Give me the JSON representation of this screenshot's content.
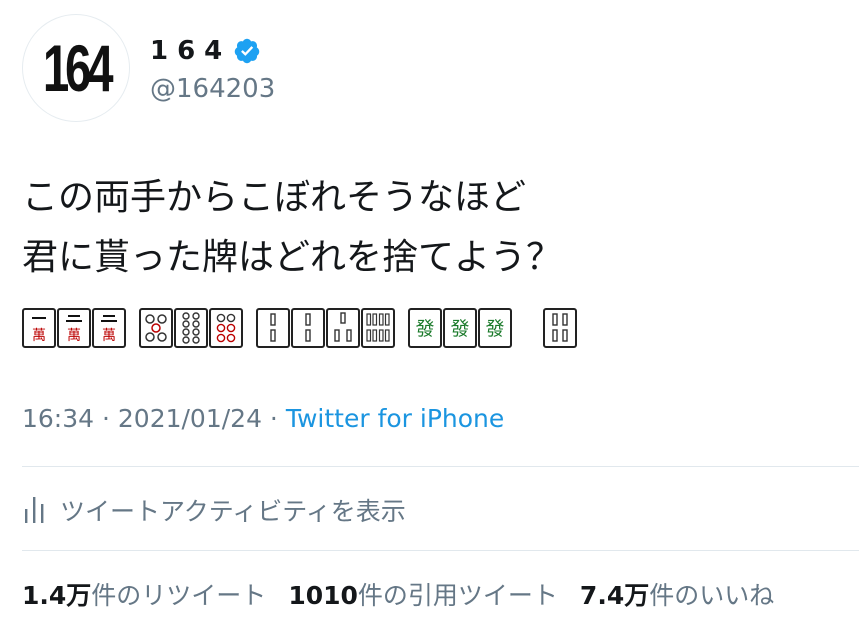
{
  "profile": {
    "avatar_text": "164",
    "display_name": "164",
    "handle": "@164203",
    "verified_icon": "verified-badge-icon",
    "verified_color": "#1da1f2"
  },
  "tweet": {
    "line1": "この両手からこぼれそうなほど",
    "line2": "君に貰った牌はどれを捨てよう？",
    "tiles": [
      {
        "suit": "man",
        "label": "一萬"
      },
      {
        "suit": "man",
        "label": "二萬"
      },
      {
        "suit": "man",
        "label": "二萬"
      },
      {
        "suit": "pin",
        "label": "五筒"
      },
      {
        "suit": "pin",
        "label": "八筒"
      },
      {
        "suit": "pin",
        "label": "六筒"
      },
      {
        "suit": "sou",
        "label": "二索"
      },
      {
        "suit": "sou",
        "label": "二索"
      },
      {
        "suit": "sou",
        "label": "三索"
      },
      {
        "suit": "sou",
        "label": "八索"
      },
      {
        "suit": "honor",
        "label": "發"
      },
      {
        "suit": "honor",
        "label": "發"
      },
      {
        "suit": "honor",
        "label": "發"
      },
      {
        "suit": "sou",
        "label": "四索"
      }
    ]
  },
  "meta": {
    "time": "16:34",
    "sep1": " · ",
    "date": "2021/01/24",
    "sep2": " · ",
    "source": "Twitter for iPhone",
    "source_color": "#1b95e0"
  },
  "activity": {
    "icon": "bar-chart-icon",
    "label": "ツイートアクティビティを表示"
  },
  "stats": {
    "retweets_num": "1.4万",
    "retweets_label": "件のリツイート",
    "quotes_num": "1010",
    "quotes_label": "件の引用ツイート",
    "likes_num": "7.4万",
    "likes_label": "件のいいね"
  }
}
